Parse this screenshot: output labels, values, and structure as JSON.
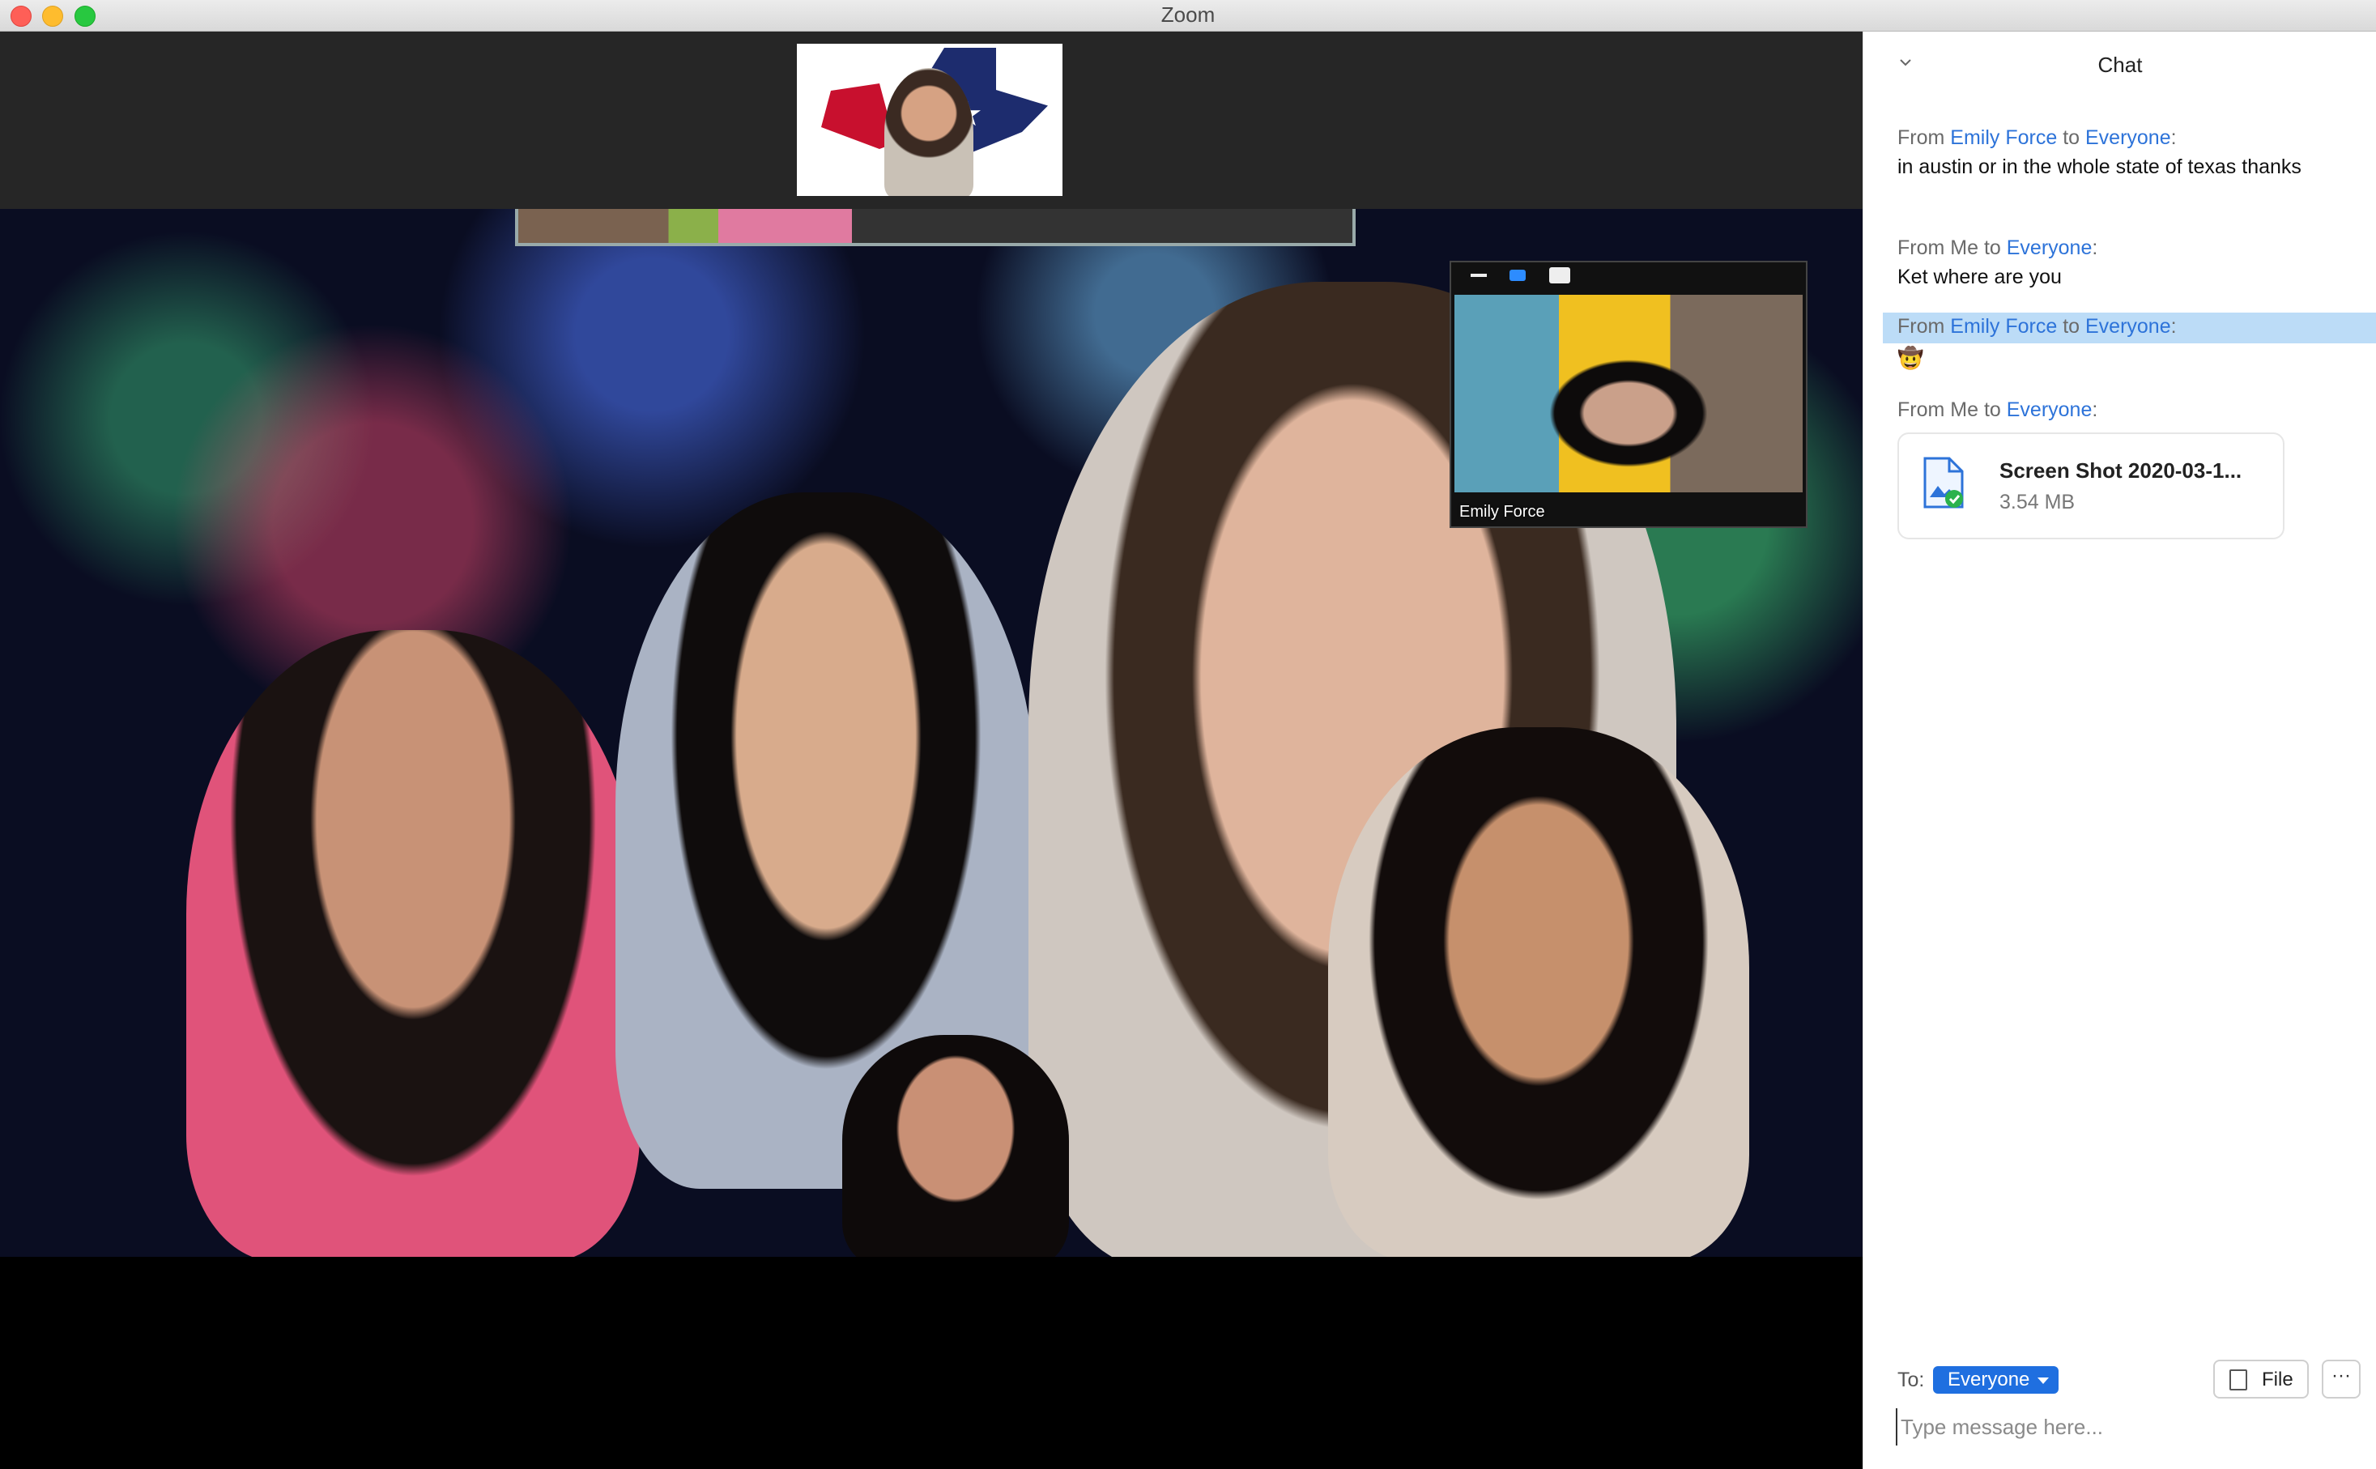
{
  "window": {
    "title": "Zoom"
  },
  "self_view": {
    "name": "Emily Force"
  },
  "chat": {
    "title": "Chat",
    "messages": [
      {
        "from_prefix": "From ",
        "from": "Emily Force",
        "to_prefix": " to ",
        "to": "Everyone",
        "suffix": ":",
        "text": "in austin or in the whole state of texas thanks"
      },
      {
        "from_prefix": "From Me to ",
        "to": "Everyone",
        "suffix": ":",
        "text": "Ket where are you"
      },
      {
        "from_prefix": "From ",
        "from": "Emily Force",
        "to_prefix": " to ",
        "to": "Everyone",
        "suffix": ":",
        "text": "🤠"
      },
      {
        "from_prefix": "From Me to ",
        "to": "Everyone",
        "suffix": ":",
        "file": {
          "name": "Screen Shot 2020-03-1...",
          "size": "3.54 MB"
        }
      }
    ],
    "composer": {
      "to_label": "To:",
      "recipient": "Everyone",
      "file_button": "File",
      "more_button": "···",
      "placeholder": "Type message here..."
    }
  },
  "colors": {
    "accent": "#1f6fe0",
    "link": "#2d73d9",
    "highlight": "#bcdcf7"
  }
}
